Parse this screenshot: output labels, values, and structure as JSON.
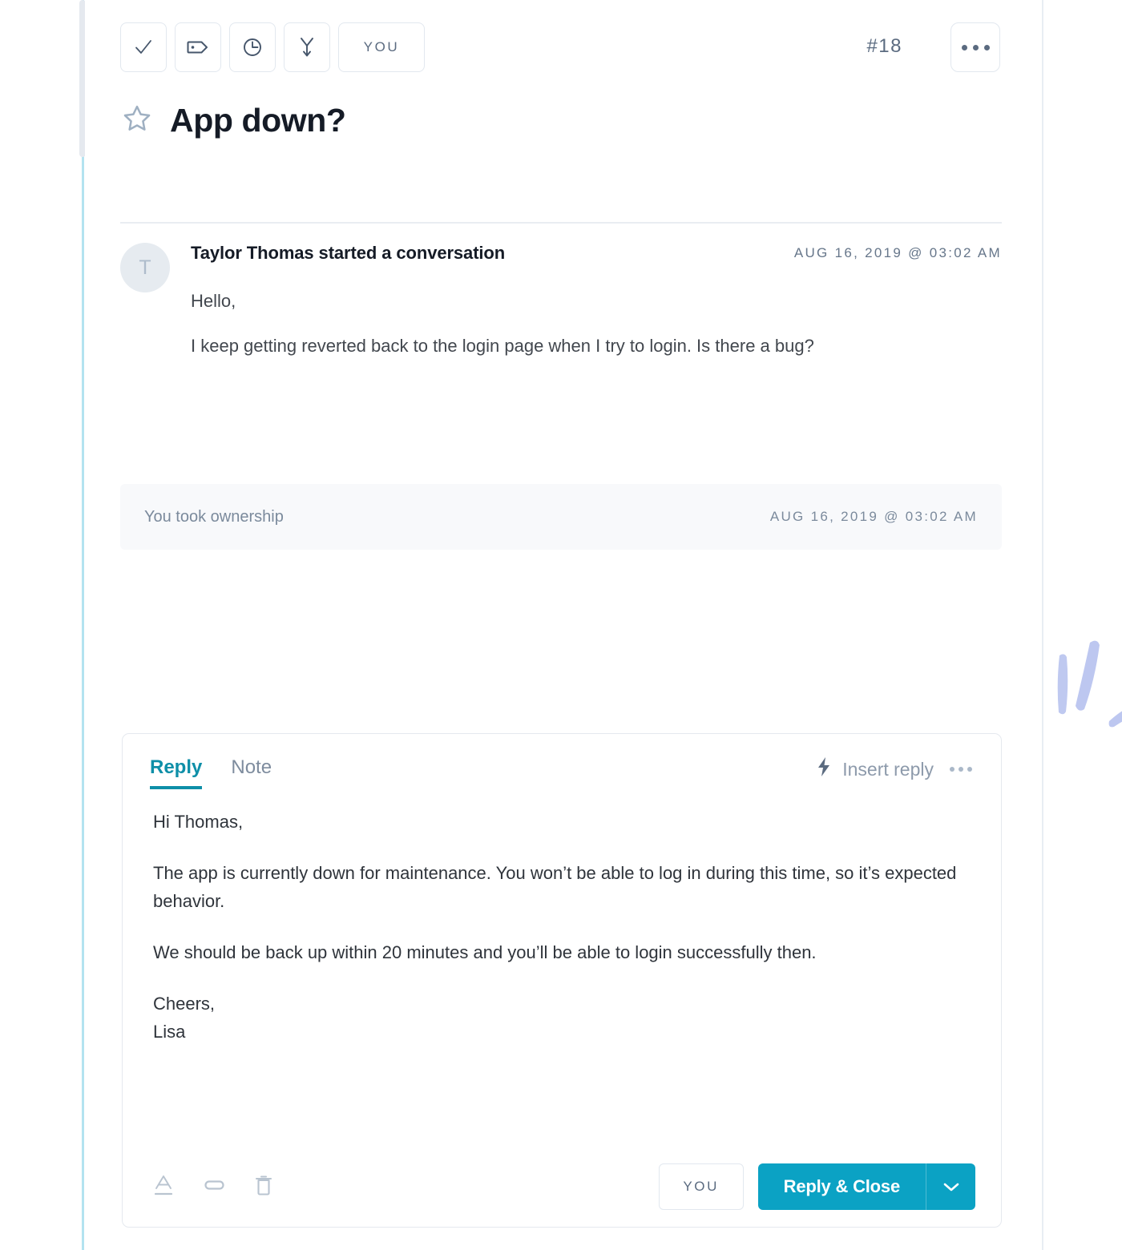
{
  "toolbar": {
    "buttons": [
      {
        "name": "close-conversation",
        "icon": "check-icon",
        "label": ""
      },
      {
        "name": "add-tag",
        "icon": "tag-icon",
        "label": ""
      },
      {
        "name": "snooze",
        "icon": "clock-icon",
        "label": ""
      },
      {
        "name": "merge",
        "icon": "merge-arrow-icon",
        "label": ""
      },
      {
        "name": "assignee",
        "icon": "",
        "label": "YOU"
      }
    ],
    "issue_number": "#18",
    "more_label": "more-options"
  },
  "header": {
    "star_icon": "star-outline-icon",
    "title": "App down?"
  },
  "conversation": {
    "entry": {
      "avatar_initial": "T",
      "author": "Taylor Thomas started a conversation",
      "timestamp": "AUG 16, 2019  @  03:02 AM",
      "paragraphs": [
        "Hello,",
        "I keep getting reverted back to the login page when I try to login. Is there a bug?"
      ]
    },
    "event": {
      "text": "You took ownership",
      "timestamp": "AUG 16, 2019  @  03:02 AM"
    }
  },
  "composer": {
    "tabs": [
      {
        "label": "Reply",
        "active": true
      },
      {
        "label": "Note",
        "active": false
      }
    ],
    "insert_reply": {
      "icon": "lightning-bolt-icon",
      "label": "Insert reply"
    },
    "paragraphs": [
      "Hi Thomas,",
      "The app is currently down for maintenance. You won’t be able to log in during this time, so it’s expected behavior.",
      "We should be back up within 20 minutes and you’ll be able to login successfully then.",
      "Cheers,\nLisa"
    ],
    "footer_icons": [
      {
        "name": "text-format-icon",
        "label": "A"
      },
      {
        "name": "attachment-icon",
        "label": ""
      },
      {
        "name": "trash-icon",
        "label": ""
      }
    ],
    "assignee_label": "YOU",
    "primary_action": "Reply & Close",
    "caret_icon": "chevron-down-icon"
  },
  "colors": {
    "accent": "#0ba2c4",
    "tab_active": "#0e8fa8",
    "icon_muted": "#5b6b80",
    "border": "#e2e8ef",
    "event_bg": "#f8f9fb",
    "brush": "#b6c1ee",
    "rail_blue": "#b3e3f0"
  }
}
